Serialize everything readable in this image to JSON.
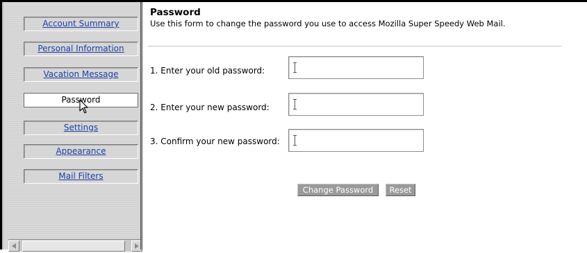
{
  "sidebar": {
    "items": [
      {
        "label": "Account Summary",
        "active": false
      },
      {
        "label": "Personal Information",
        "active": false
      },
      {
        "label": "Vacation Message",
        "active": false
      },
      {
        "label": "Password",
        "active": true
      },
      {
        "label": "Settings",
        "active": false
      },
      {
        "label": "Appearance",
        "active": false
      },
      {
        "label": "Mail Filters",
        "active": false
      }
    ]
  },
  "main": {
    "title": "Password",
    "description": "Use this form to change the password you use to access Mozilla Super Speedy Web Mail.",
    "fields": [
      {
        "label": "1. Enter your old password:",
        "value": ""
      },
      {
        "label": "2. Enter your new password:",
        "value": ""
      },
      {
        "label": "3. Confirm your new password:",
        "value": ""
      }
    ],
    "buttons": {
      "change_label": "Change Password",
      "reset_label": "Reset"
    }
  },
  "colors": {
    "link": "#1a3faa",
    "sidebar_bg": "#d4d4d4",
    "button_bg": "#9a9a9a"
  }
}
